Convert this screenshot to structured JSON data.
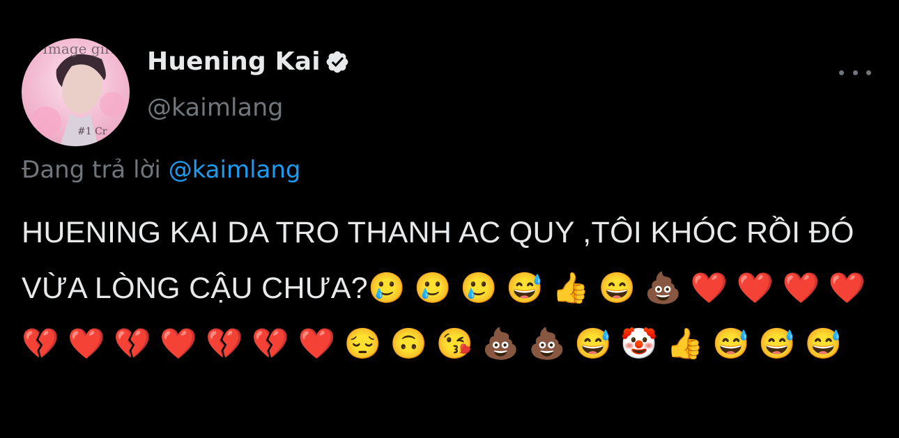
{
  "author": {
    "display_name": "Huening Kai",
    "handle": "@kaimlang",
    "avatar_overlay_top": "Image girls",
    "avatar_overlay_bottom": "#1 Cr"
  },
  "reply": {
    "prefix": "Đang trả lời ",
    "mention": "@kaimlang"
  },
  "tweet": {
    "text": "HUENING KAI DA TRO THANH AC QUY ,TÔI KHÓC RỒI ĐÓ VỪA LÒNG CẬU CHƯA?🥲 🥲 🥲 😅 👍 😄 💩 ❤️ ❤️ ❤️ ❤️ 💔 ❤️ 💔 ❤️ 💔 💔 ❤️ 😔 🙃 😘 💩 💩 😅 🤡 👍 😅 😅 😅"
  },
  "colors": {
    "background": "#000000",
    "text_primary": "#e7e9ea",
    "text_secondary": "#71767b",
    "accent": "#1d9bf0"
  },
  "icons": {
    "verified": "verified-badge-icon",
    "more": "more-options-icon"
  }
}
